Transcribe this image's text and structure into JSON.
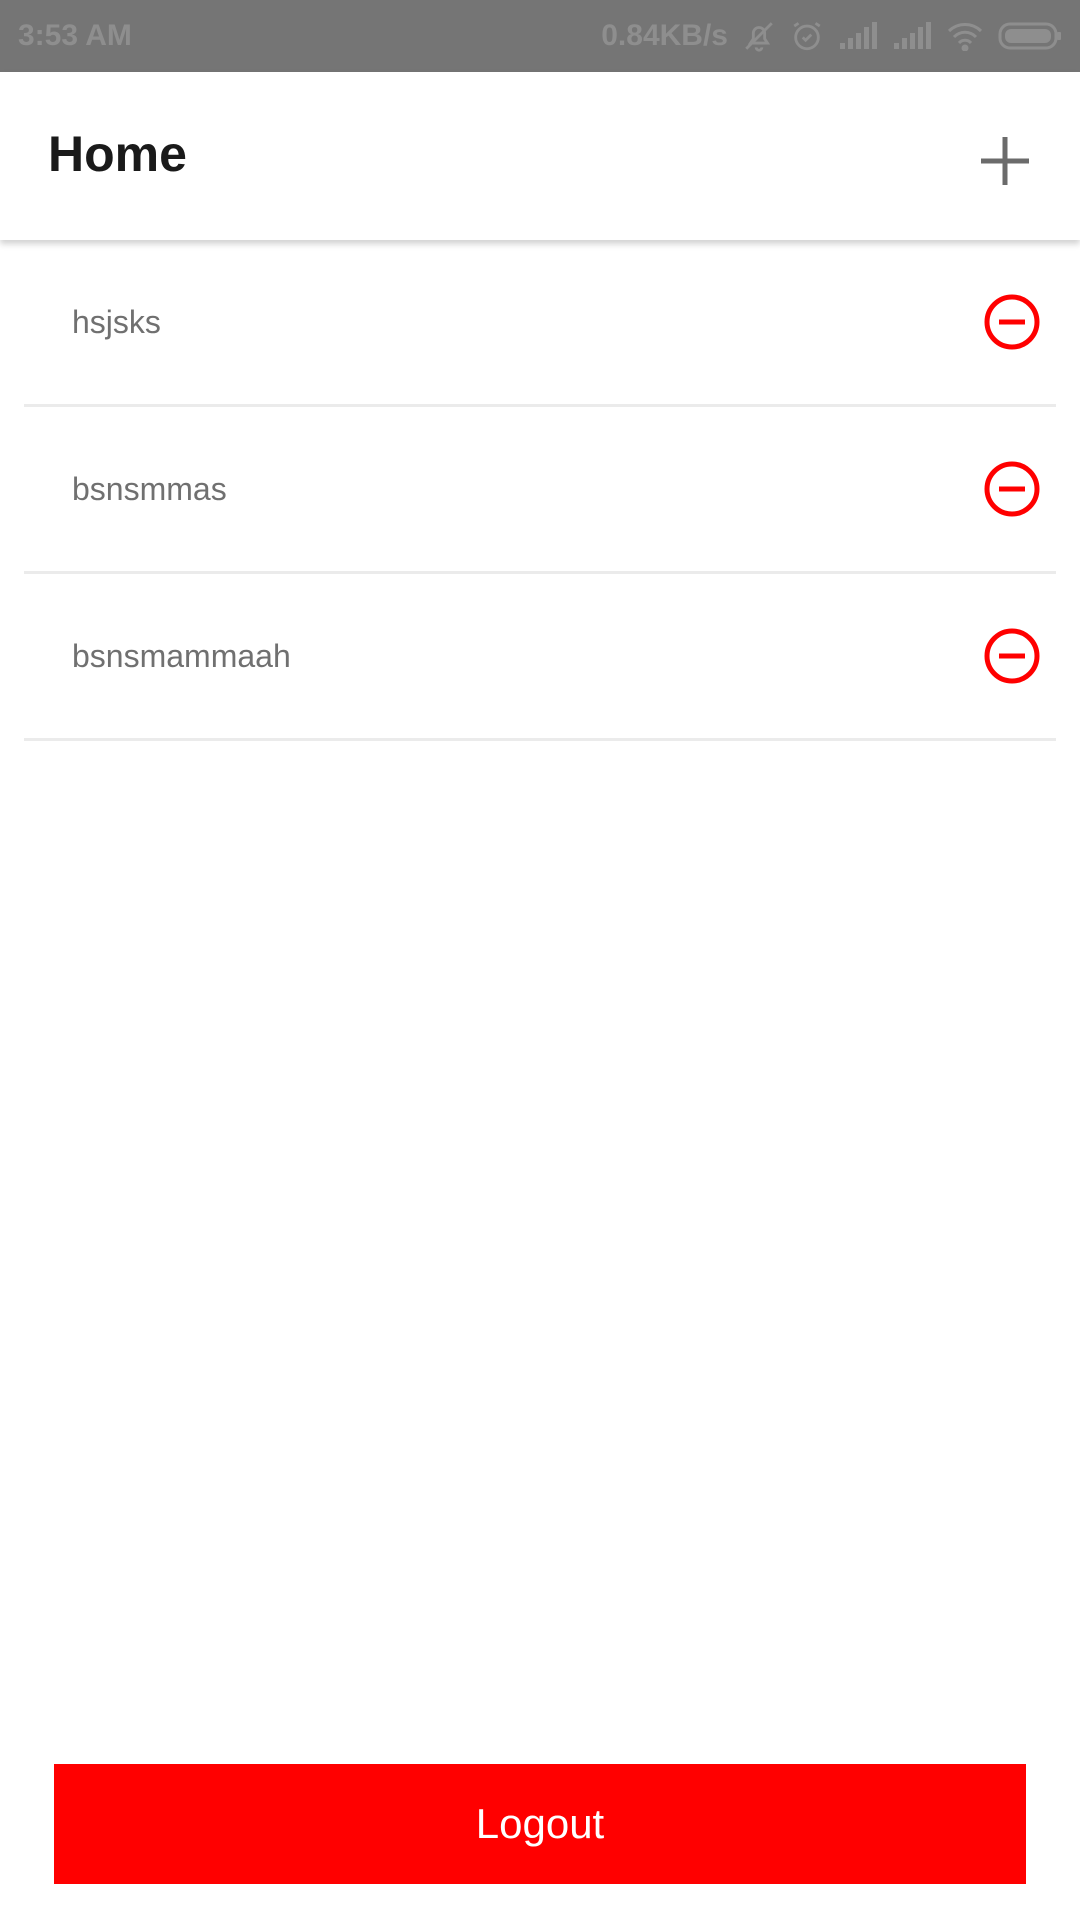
{
  "status_bar": {
    "time": "3:53 AM",
    "network_speed": "0.84KB/s",
    "icons": [
      "bell-off-icon",
      "alarm-icon",
      "signal-icon",
      "signal-icon",
      "wifi-icon",
      "battery-icon"
    ]
  },
  "app_bar": {
    "title": "Home",
    "add_icon": "plus-icon"
  },
  "list": {
    "items": [
      {
        "label": "hsjsks",
        "action_icon": "remove-circle-icon"
      },
      {
        "label": "bsnsmmas",
        "action_icon": "remove-circle-icon"
      },
      {
        "label": "bsnsmammaah",
        "action_icon": "remove-circle-icon"
      }
    ]
  },
  "logout": {
    "label": "Logout"
  },
  "colors": {
    "accent": "#ff0000",
    "status_bar": "#757575",
    "item_text": "#707070",
    "title_text": "#1a1a1a"
  }
}
